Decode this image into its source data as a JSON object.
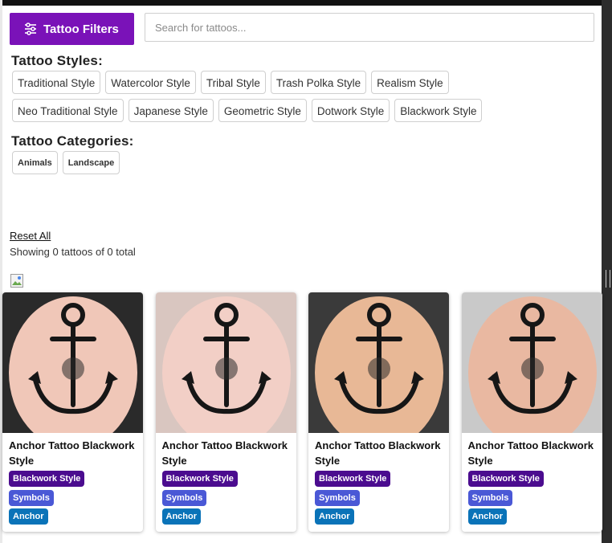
{
  "header": {
    "filters_button_label": "Tattoo Filters",
    "search_placeholder": "Search for tattoos..."
  },
  "styles": {
    "title": "Tattoo Styles:",
    "items": [
      "Traditional Style",
      "Watercolor Style",
      "Tribal Style",
      "Trash Polka Style",
      "Realism Style",
      "Neo Traditional Style",
      "Japanese Style",
      "Geometric Style",
      "Dotwork Style",
      "Blackwork Style"
    ]
  },
  "categories": {
    "title": "Tattoo Categories:",
    "items": [
      "Animals",
      "Landscape"
    ]
  },
  "results": {
    "reset_label": "Reset All",
    "count_text": "Showing 0 tattoos of 0 total"
  },
  "cards": [
    {
      "title": "Anchor Tattoo Blackwork Style",
      "tags": [
        "Blackwork Style",
        "Symbols",
        "Anchor"
      ],
      "skin": "#f0c7b8",
      "bg": "#2a2a2a"
    },
    {
      "title": "Anchor Tattoo Blackwork Style",
      "tags": [
        "Blackwork Style",
        "Symbols",
        "Anchor"
      ],
      "skin": "#f2cfc6",
      "bg": "#d9c6c0"
    },
    {
      "title": "Anchor Tattoo Blackwork Style",
      "tags": [
        "Blackwork Style",
        "Symbols",
        "Anchor"
      ],
      "skin": "#e8b896",
      "bg": "#3a3a3a"
    },
    {
      "title": "Anchor Tattoo Blackwork Style",
      "tags": [
        "Blackwork Style",
        "Symbols",
        "Anchor"
      ],
      "skin": "#e9b8a1",
      "bg": "#c9c9c9"
    }
  ],
  "colors": {
    "brand_purple": "#7a12b8",
    "tag_style": "#4b0c8f",
    "tag_symbols": "#4a58d6",
    "tag_anchor": "#0a73b8"
  }
}
